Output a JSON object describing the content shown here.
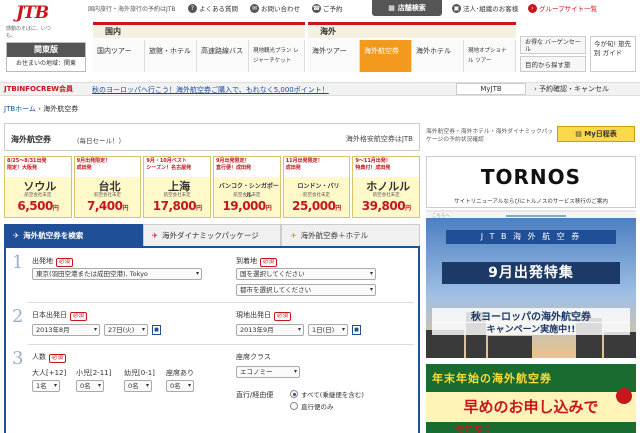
{
  "header": {
    "logo_text": "JTB",
    "logo_tagline": "感動のそばに、いつも。",
    "top_tagline": "国内旅行・海外旅行の予約はJTB",
    "links": [
      "よくある質問",
      "お問い合わせ",
      "ご予約"
    ],
    "store_search": "店舗検索",
    "corp_link": "法人･組織のお客様",
    "group_link": "グループサイト一覧",
    "region": {
      "title": "関東版",
      "sub": "お住まいの地域：関東"
    }
  },
  "nav": {
    "domestic_label": "国内",
    "international_label": "海外",
    "domestic_items": [
      "国内ツアー",
      "旅館・ホテル",
      "高速路線バス",
      "現地観光プラン レジャーチケット"
    ],
    "international_items": [
      "海外ツアー",
      "海外航空券",
      "海外ホテル",
      "現地オプショナル ツアー"
    ],
    "side": [
      "お得な バーゲンセール",
      "目的から探す旅"
    ],
    "guide": "今が旬! 旅先別 ガイド"
  },
  "member_bar": {
    "brand": "JTBINFOCREW会員",
    "message": "秋のヨーロッパへ行こう！海外航空券ご購入で、もれなく5,000ポイント！",
    "myjtb": "MyJTB",
    "reserve": "予約確認・キャンセル"
  },
  "breadcrumb": [
    "JTBホーム",
    "海外航空券"
  ],
  "title": {
    "main": "海外航空券",
    "sub": "（毎日セール！）",
    "right": "海外格安航空券はJTB",
    "side_note": "海外航空券・海外ホテル・海外ダイナミックパッケージの予約状況確認",
    "schedule_button": "My日程表"
  },
  "price_cards": [
    {
      "tag": "8/25〜8/31出発\n限定！大阪発",
      "city": "ソウル",
      "note": "航空会社未定",
      "price": "6,500",
      "unit": "円"
    },
    {
      "tag": "9月出発限定！\n成田発",
      "city": "台北",
      "note": "航空会社未定",
      "price": "7,400",
      "unit": "円"
    },
    {
      "tag": "9月・10月ベスト\nシーズン！名古屋発",
      "city": "上海",
      "note": "航空会社未定",
      "price": "17,800",
      "unit": "円"
    },
    {
      "tag": "9月出発限定！\n直行便！成田発",
      "city": "バンコク・シンガポール",
      "note": "航空会社未定",
      "price": "19,000",
      "unit": "円"
    },
    {
      "tag": "11月出発限定！\n成田発",
      "city": "ロンドン・パリ",
      "note": "航空会社未定",
      "price": "25,000",
      "unit": "円"
    },
    {
      "tag": "9〜11月出発！\n特典付！成田発",
      "city": "ホノルル",
      "note": "航空会社未定",
      "price": "39,800",
      "unit": "円"
    }
  ],
  "tabs": [
    "海外航空券を検索",
    "海外ダイナミックパッケージ",
    "海外航空券＋ホテル"
  ],
  "form": {
    "required": "必須",
    "origin_label": "出発地",
    "origin_value": "東京(羽田空港または成田空港), Tokyo",
    "dest_label": "到着地",
    "dest_country": "国を選択してください",
    "dest_city": "都市を選択してください",
    "depart_label": "日本出発日",
    "depart_month": "2013年8月",
    "depart_day": "27日(火)",
    "return_label": "現地出発日",
    "return_month": "2013年9月",
    "return_day": "1日(日)",
    "people_label": "人数",
    "adult_label": "大人[+12]",
    "child_label": "小児[2-11]",
    "infant_label": "幼児[0-1]",
    "seat_label": "座席あり",
    "adult_value": "1名",
    "child_value": "0名",
    "infant_value": "0名",
    "seat_value": "0名",
    "class_label": "座席クラス",
    "class_value": "エコノミー",
    "route_label": "直行/経由便",
    "route_opt1": "すべて(乗継便を含む)",
    "route_opt2": "直行便のみ",
    "cal_glyph": "■"
  },
  "ads": {
    "tornos": "TORNOS",
    "tornos_caption": "サイトリニューアルならびにトルノスのサービス移行のご案内",
    "scroll_hint": "こちらへ",
    "europe_ribbon": "J T B 海 外 航 空 券",
    "europe_big": "9月出発特集",
    "europe_line1": "秋ヨーロッパの海外航空券",
    "europe_line2": "キャンペーン実施中!!",
    "newyear_l1": "年末年始の海外航空券",
    "newyear_l2": "早めのお申し込みで",
    "newyear_l3": "もれなく"
  },
  "colors": {
    "brand_red": "#c8161d",
    "nav_orange": "#f39a1e",
    "form_blue": "#1f4f96",
    "price_yellow": "#fff8c8"
  }
}
